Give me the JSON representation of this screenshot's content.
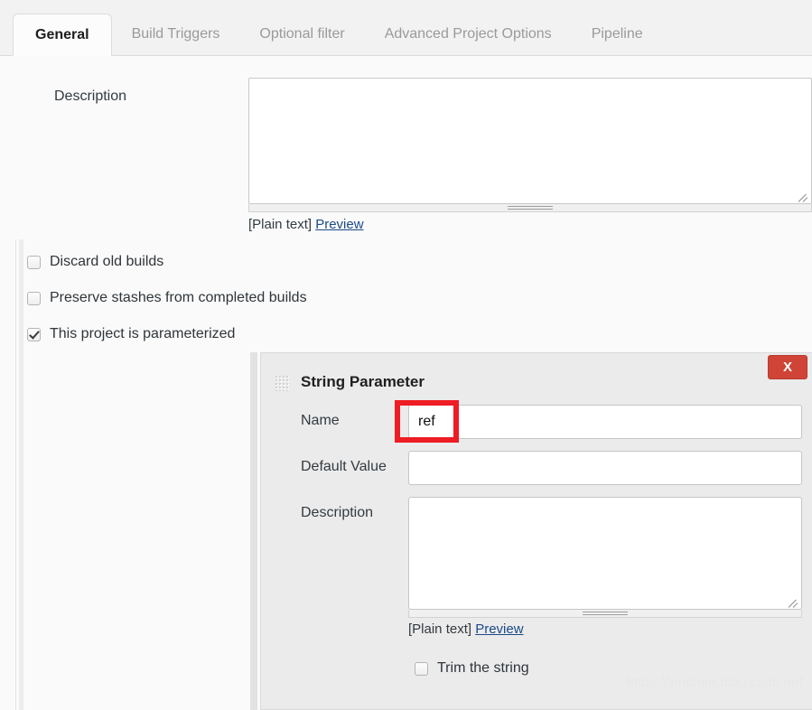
{
  "tabs": [
    {
      "label": "General",
      "active": true
    },
    {
      "label": "Build Triggers",
      "active": false
    },
    {
      "label": "Optional filter",
      "active": false
    },
    {
      "label": "Advanced Project Options",
      "active": false
    },
    {
      "label": "Pipeline",
      "active": false
    }
  ],
  "general": {
    "description_label": "Description",
    "description_value": "",
    "description_placeholder": "",
    "markup_note": "[Plain text]",
    "preview_link": "Preview"
  },
  "options": [
    {
      "label": "Discard old builds",
      "checked": false
    },
    {
      "label": "Preserve stashes from completed builds",
      "checked": false
    },
    {
      "label": "This project is parameterized",
      "checked": true
    }
  ],
  "parameter": {
    "title": "String Parameter",
    "delete_label": "X",
    "name_label": "Name",
    "name_value": "ref",
    "default_label": "Default Value",
    "default_value": "",
    "description_label": "Description",
    "description_value": "",
    "markup_note": "[Plain text]",
    "preview_link": "Preview",
    "trim_label": "Trim the string",
    "trim_checked": false
  },
  "annotation": {
    "color": "#ee1c24",
    "target": "name_value"
  },
  "watermark": "https://xinchen.blog.csdn.net"
}
